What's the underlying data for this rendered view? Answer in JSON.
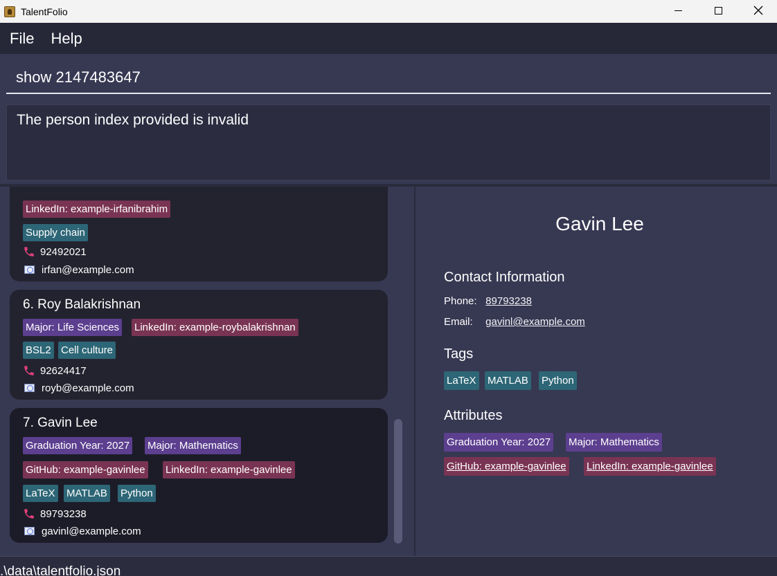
{
  "window": {
    "title": "TalentFolio",
    "minimize_icon": "minimize-icon",
    "maximize_icon": "maximize-icon",
    "close_icon": "close-icon"
  },
  "menu": {
    "items": [
      {
        "label": "File"
      },
      {
        "label": "Help"
      }
    ]
  },
  "command": {
    "value": "show 2147483647"
  },
  "result": {
    "message": "The person index provided is invalid"
  },
  "list": {
    "cards": [
      {
        "name": "",
        "tags_row1": [
          {
            "text": "LinkedIn: example-irfanibrahim",
            "color": "#7a3453"
          }
        ],
        "tags_row2": [
          {
            "text": "Supply chain",
            "color": "#2d6676"
          }
        ],
        "phone": "92492021",
        "email": "irfan@example.com"
      },
      {
        "name": "6. Roy Balakrishnan",
        "tags_row1": [
          {
            "text": "Major: Life Sciences",
            "color": "#5c3f8f"
          },
          {
            "text": "LinkedIn: example-roybalakrishnan",
            "color": "#7a3453"
          }
        ],
        "tags_row2": [
          {
            "text": "BSL2",
            "color": "#2d6676"
          },
          {
            "text": "Cell culture",
            "color": "#2d6676"
          }
        ],
        "phone": "92624417",
        "email": "royb@example.com"
      },
      {
        "name": "7. Gavin Lee",
        "tags_row1": [
          {
            "text": "Graduation Year: 2027",
            "color": "#5c3f8f"
          },
          {
            "text": "Major: Mathematics",
            "color": "#5c3f8f"
          }
        ],
        "tags_row2": [
          {
            "text": "GitHub: example-gavinlee",
            "color": "#7a3453"
          },
          {
            "text": "LinkedIn: example-gavinlee",
            "color": "#7a3453"
          }
        ],
        "tags_row3": [
          {
            "text": "LaTeX",
            "color": "#2d6676"
          },
          {
            "text": "MATLAB",
            "color": "#2d6676"
          },
          {
            "text": "Python",
            "color": "#2d6676"
          }
        ],
        "phone": "89793238",
        "email": "gavinl@example.com"
      }
    ]
  },
  "detail": {
    "name": "Gavin Lee",
    "contact_title": "Contact Information",
    "phone_label": "Phone:",
    "phone": "89793238",
    "email_label": "Email:",
    "email": "gavinl@example.com",
    "tags_title": "Tags",
    "tags": [
      "LaTeX",
      "MATLAB",
      "Python"
    ],
    "attributes_title": "Attributes",
    "attributes": [
      {
        "text": "Graduation Year: 2027",
        "color": "#5c3f8f"
      },
      {
        "text": "Major: Mathematics",
        "color": "#5c3f8f"
      },
      {
        "text": "GitHub: example-gavinlee",
        "color": "#7a3453"
      },
      {
        "text": "LinkedIn: example-gavinlee",
        "color": "#7a3453"
      }
    ]
  },
  "status": {
    "path": ".\\data\\talentfolio.json"
  },
  "colors": {
    "background": "#373852",
    "card": "#23232f",
    "tag_purple": "#5c3f8f",
    "tag_pink": "#7a3453",
    "tag_teal": "#2d6676",
    "phone_icon": "#e0407a"
  }
}
